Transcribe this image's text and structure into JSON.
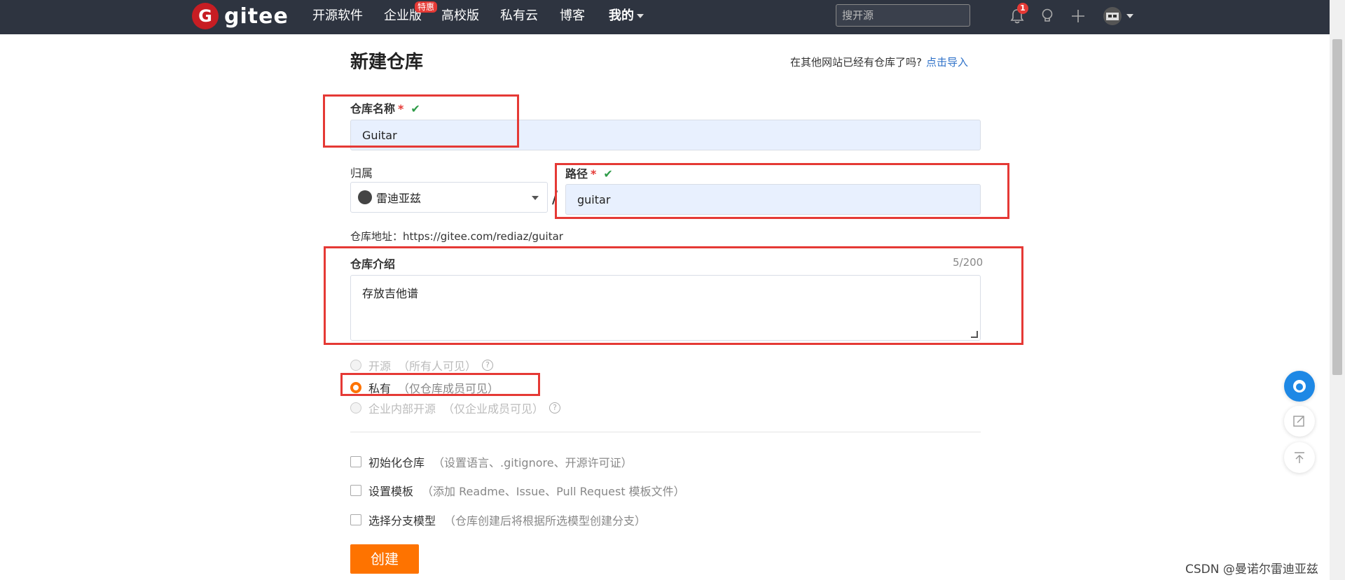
{
  "topbar": {
    "logo_mark": "G",
    "logo_text": "gitee",
    "nav": [
      "开源软件",
      "企业版",
      "高校版",
      "私有云",
      "博客",
      "我的"
    ],
    "promo_badge": "特惠",
    "search_placeholder": "搜开源",
    "notification_count": "1"
  },
  "page": {
    "title": "新建仓库",
    "import_hint": "在其他网站已经有仓库了吗?",
    "import_link": "点击导入"
  },
  "form": {
    "name_label": "仓库名称",
    "required_mark": "*",
    "check_mark": "✔",
    "name_value": "Guitar",
    "owner_label": "归属",
    "owner_value": "雷迪亚兹",
    "slash": "/",
    "path_label": "路径",
    "path_value": "guitar",
    "url_text": "仓库地址：https://gitee.com/rediaz/guitar",
    "desc_label": "仓库介绍",
    "desc_counter": "5/200",
    "desc_value": "存放吉他谱",
    "visibility": [
      {
        "label": "开源",
        "sub": "（所有人可见）",
        "selected": false,
        "disabled": true,
        "help": true
      },
      {
        "label": "私有",
        "sub": "（仅仓库成员可见）",
        "selected": true,
        "disabled": false,
        "help": false
      },
      {
        "label": "企业内部开源",
        "sub": "（仅企业成员可见）",
        "selected": false,
        "disabled": true,
        "help": true
      }
    ],
    "help_glyph": "?",
    "options": [
      {
        "label": "初始化仓库",
        "sub": "（设置语言、.gitignore、开源许可证）"
      },
      {
        "label": "设置模板",
        "sub": "（添加 Readme、Issue、Pull Request 模板文件）"
      },
      {
        "label": "选择分支模型",
        "sub": "（仓库创建后将根据所选模型创建分支）"
      }
    ],
    "create_button": "创建"
  },
  "watermark": "CSDN @曼诺尔雷迪亚兹",
  "colors": {
    "accent": "#fe7300",
    "topbar": "#2e3440",
    "highlight": "#e53935",
    "link": "#2f72c9",
    "valid": "#2e9b48"
  }
}
